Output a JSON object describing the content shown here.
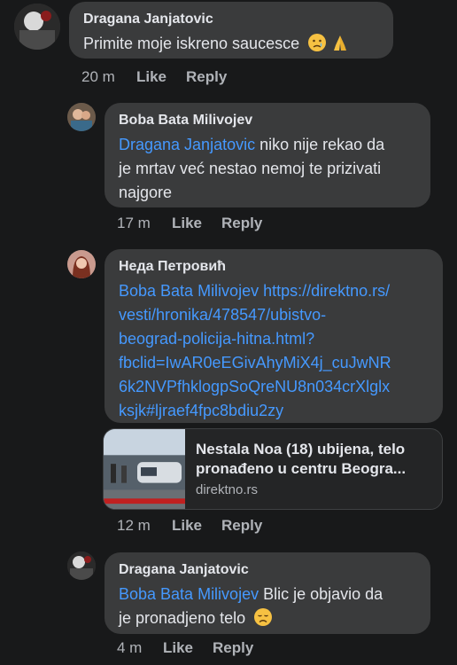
{
  "comments": [
    {
      "author": "Dragana Janjatovic",
      "text": "Primite moje iskreno saucesce",
      "emoji": [
        "crying-face",
        "folded-hands"
      ],
      "time": "20 m",
      "like": "Like",
      "reply": "Reply"
    },
    {
      "author": "Boba Bata Milivojev",
      "mention": "Dragana Janjatovic",
      "text_line1": " niko nije rekao da",
      "text_line2": "je mrtav već nestao nemoj te prizivati",
      "text_line3": "najgore",
      "time": "17 m",
      "like": "Like",
      "reply": "Reply"
    },
    {
      "author": "Неда Петровић",
      "mention": "Boba Bata Milivojev",
      "url_line1": " https://direktno.rs/",
      "url_line2": "vesti/hronika/478547/ubistvo-",
      "url_line3": "beograd-policija-hitna.html?",
      "url_line4": "fbclid=IwAR0eEGivAhyMiX4j_cuJwNR",
      "url_line5": "6k2NVPfhklogpSoQreNU8n034crXlglx",
      "url_line6": "ksjk#ljraef4fpc8bdiu2zy",
      "preview": {
        "title_line1": "Nestala Noa (18) ubijena, telo",
        "title_line2": "pronađeno u centru Beogra...",
        "domain": "direktno.rs"
      },
      "time": "12 m",
      "like": "Like",
      "reply": "Reply"
    },
    {
      "author": "Dragana Janjatovic",
      "mention": "Boba Bata Milivojev",
      "text_line1": "  Blic je objavio da",
      "text_line2": "je pronadjeno telo",
      "emoji": [
        "disappointed-face"
      ],
      "time": "4 m",
      "like": "Like",
      "reply": "Reply"
    }
  ],
  "colors": {
    "background": "#18191a",
    "bubble": "#3a3b3c",
    "link": "#4599ff",
    "meta": "#b0b3b8"
  }
}
